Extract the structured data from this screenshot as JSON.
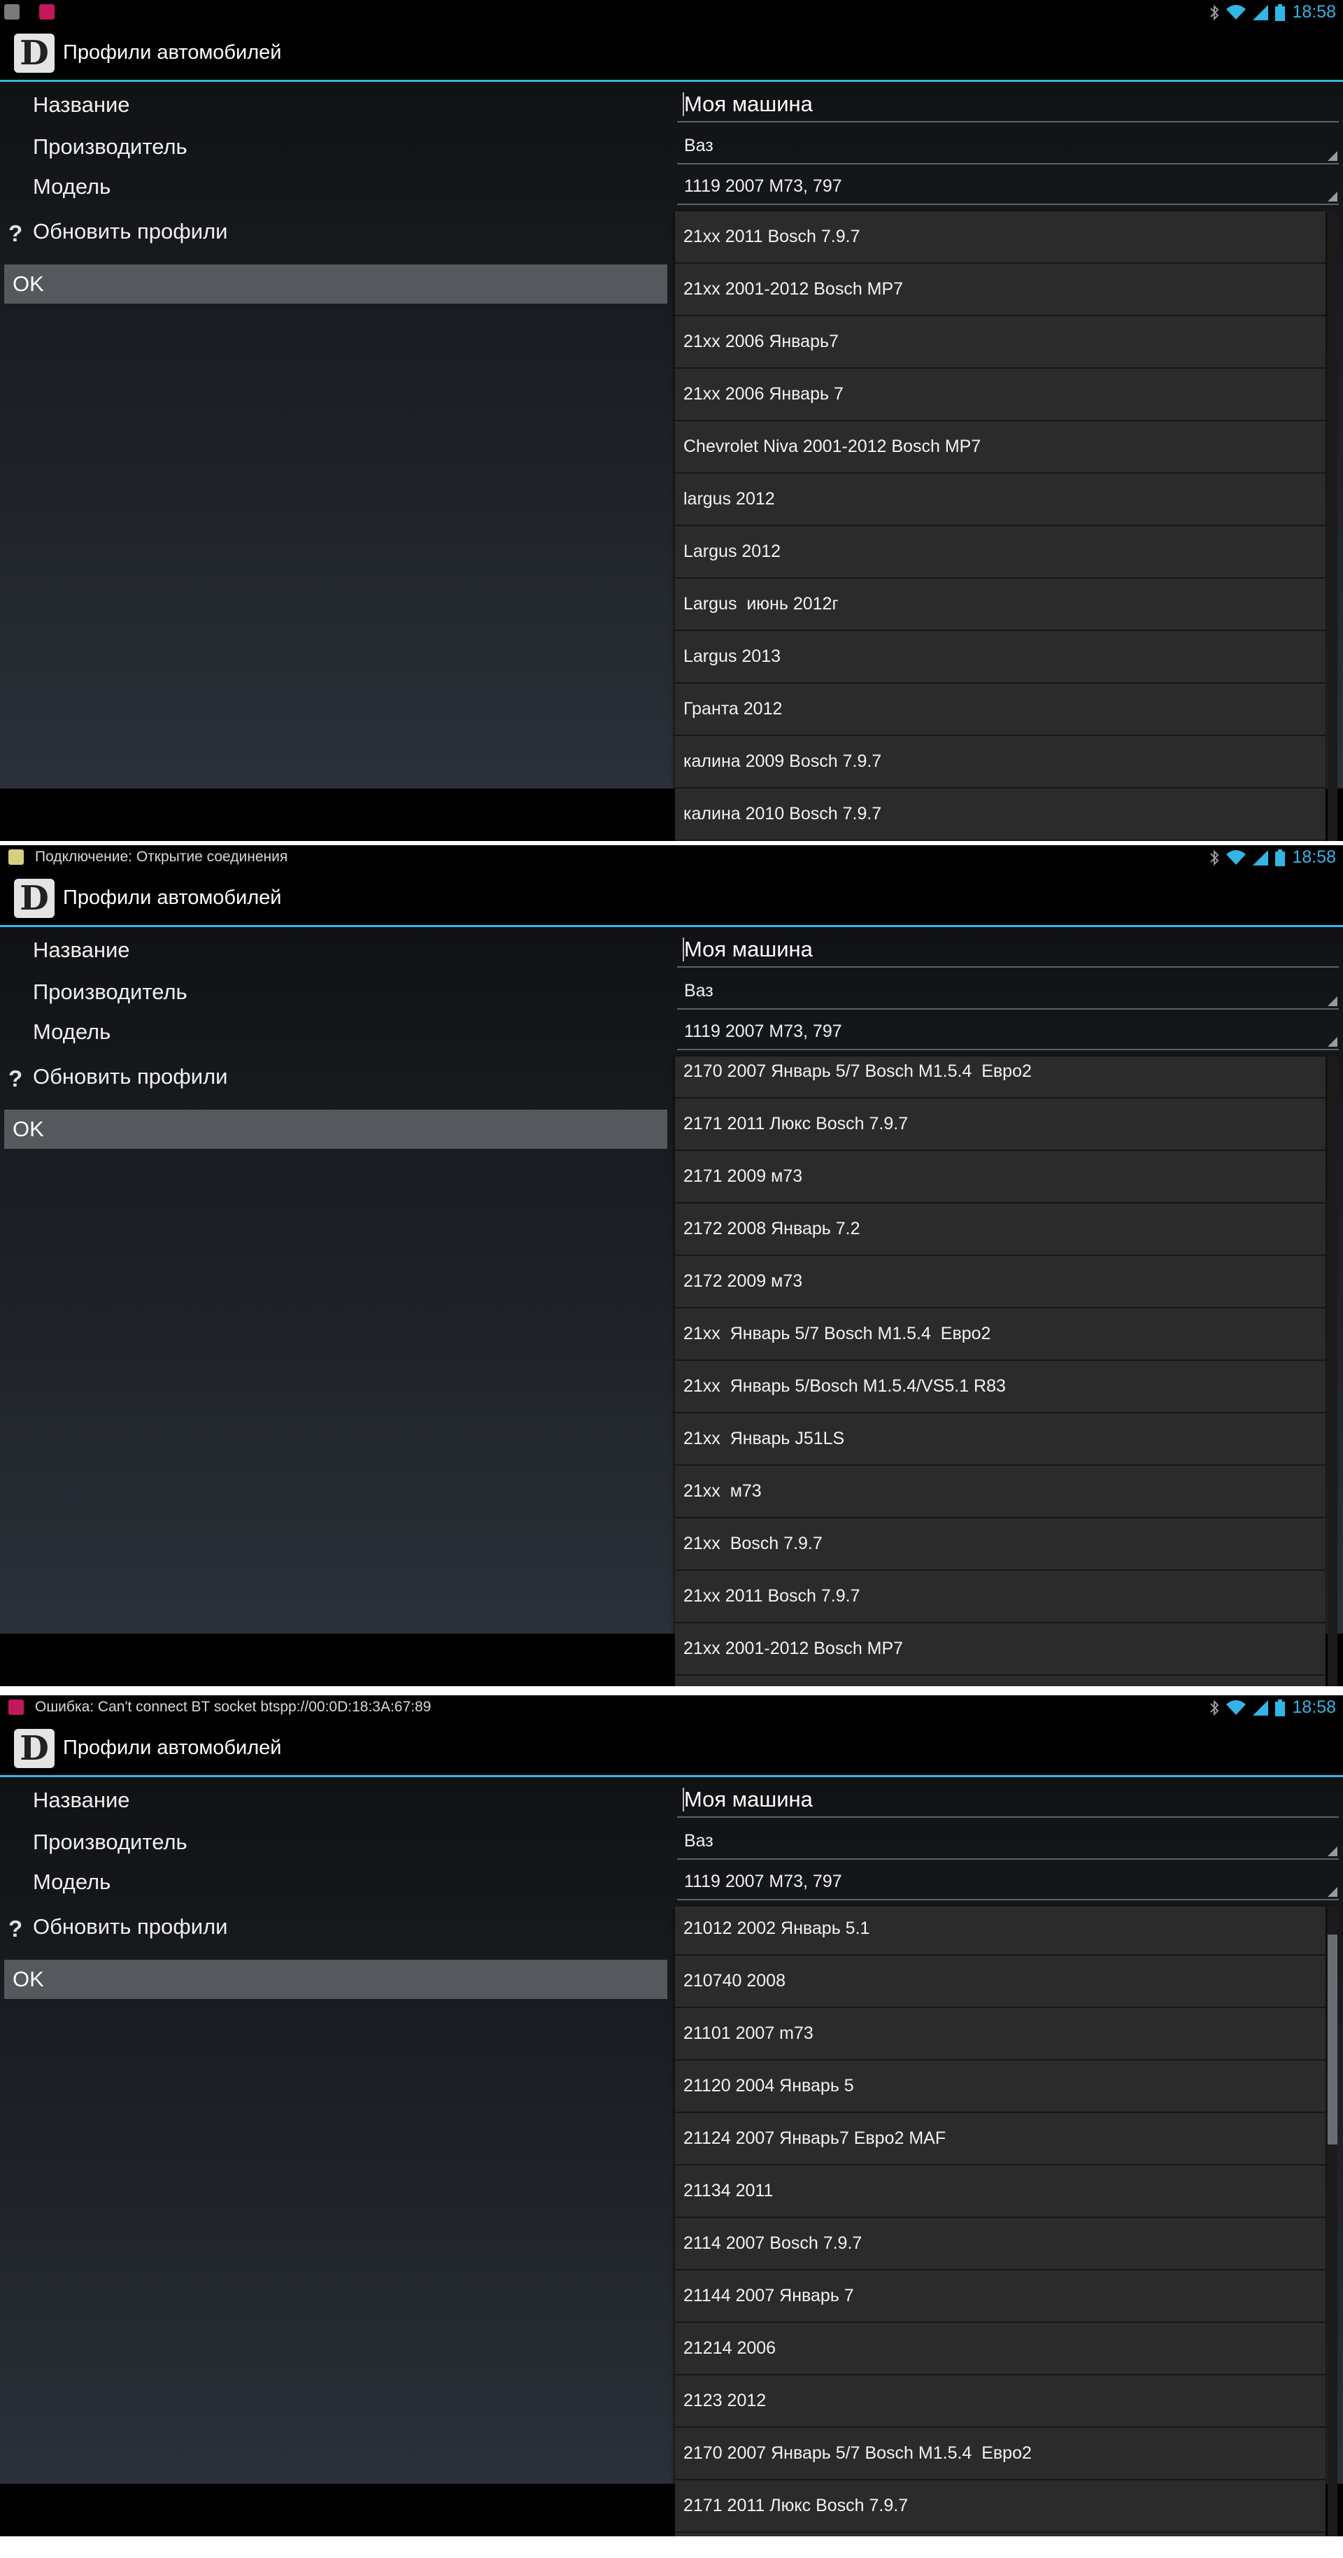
{
  "colors": {
    "accent": "#33b5e5",
    "ok_bg": "#55585c",
    "dropdown_bg": "#2b2b2b"
  },
  "status": {
    "time": "18:58"
  },
  "app": {
    "title": "Профили автомобилей",
    "icon_letter": "D"
  },
  "form": {
    "name_label": "Название",
    "maker_label": "Производитель",
    "model_label": "Модель",
    "refresh_label": "Обновить профили",
    "refresh_icon": "?",
    "ok_label": "OK",
    "name_value": "Моя машина",
    "maker_value": "Ваз",
    "model_value": "1119 2007 M73, 797"
  },
  "notifications": [
    "",
    "Подключение: Открытие соединения",
    "Ошибка: Can't connect BT socket btspp://00:0D:18:3A:67:89"
  ],
  "screens": [
    {
      "items": [
        "21xx 2011 Bosch 7.9.7",
        "21xx 2001-2012 Bosch MP7",
        "21xx 2006 Январь7",
        "21xx 2006 Январь 7",
        "Chevrolet Niva 2001-2012 Bosch MP7",
        "largus 2012",
        "Largus 2012",
        "Largus  июнь 2012г",
        "Largus 2013",
        "Гранта 2012",
        "калина 2009 Bosch 7.9.7",
        "калина 2010 Bosch 7.9.7"
      ]
    },
    {
      "items": [
        "2170 2007 Январь 5/7 Bosch M1.5.4  Евро2",
        "2171 2011 Люкс Bosch 7.9.7",
        "2171 2009 м73",
        "2172 2008 Январь 7.2",
        "2172 2009 м73",
        "21xx  Январь 5/7 Bosch M1.5.4  Евро2",
        "21xx  Январь 5/Bosch M1.5.4/VS5.1 R83",
        "21xx  Январь J51LS",
        "21xx  м73",
        "21xx  Bosch 7.9.7",
        "21xx 2011 Bosch 7.9.7",
        "21xx 2001-2012 Bosch MP7"
      ]
    },
    {
      "items": [
        "21012 2002 Январь 5.1",
        "210740 2008",
        "21101 2007 m73",
        "21120 2004 Январь 5",
        "21124 2007 Январь7 Евро2 MAF",
        "21134 2011",
        "2114 2007 Bosch 7.9.7",
        "21144 2007 Январь 7",
        "21214 2006",
        "2123 2012",
        "2170 2007 Январь 5/7 Bosch M1.5.4  Евро2",
        "2171 2011 Люкс Bosch 7.9.7"
      ]
    }
  ]
}
